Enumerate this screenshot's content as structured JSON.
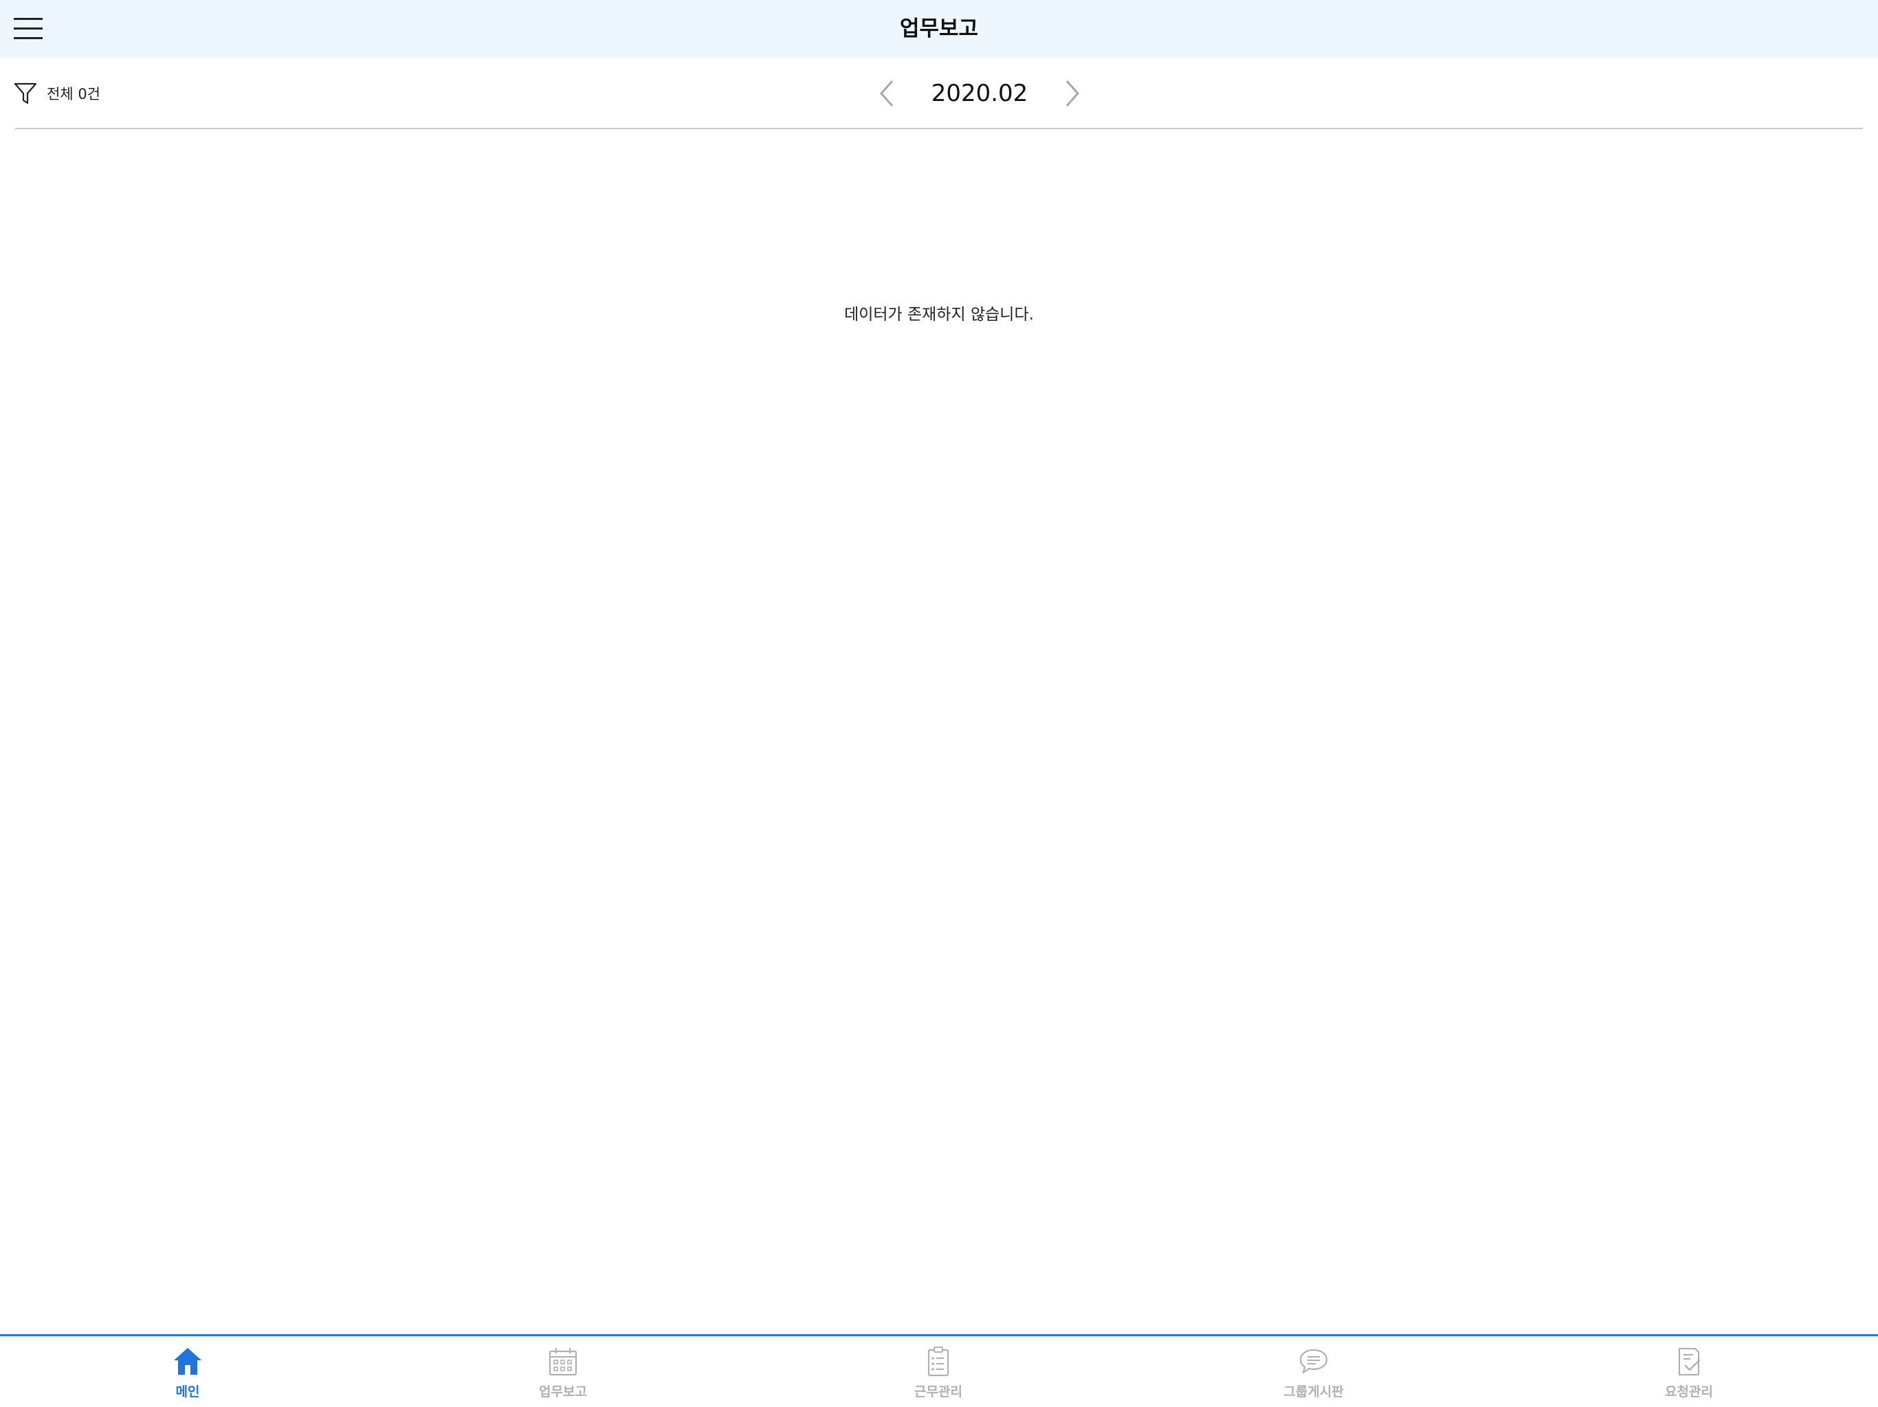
{
  "header": {
    "title": "업무보고",
    "menu_icon": "hamburger-menu-icon"
  },
  "toolbar": {
    "filter_icon": "filter-icon",
    "filter_label": "전체 0건",
    "month": "2020.02",
    "prev_icon": "chevron-left-icon",
    "next_icon": "chevron-right-icon"
  },
  "content": {
    "empty_message": "데이터가 존재하지 않습니다."
  },
  "tabbar": {
    "active_color": "#1f74e0",
    "inactive_color": "#b0b0b0",
    "items": [
      {
        "label": "메인",
        "icon": "home-icon",
        "active": true
      },
      {
        "label": "업무보고",
        "icon": "calendar-icon",
        "active": false
      },
      {
        "label": "근무관리",
        "icon": "clipboard-icon",
        "active": false
      },
      {
        "label": "그룹게시판",
        "icon": "chat-bubble-icon",
        "active": false
      },
      {
        "label": "요청관리",
        "icon": "request-document-icon",
        "active": false
      }
    ]
  }
}
